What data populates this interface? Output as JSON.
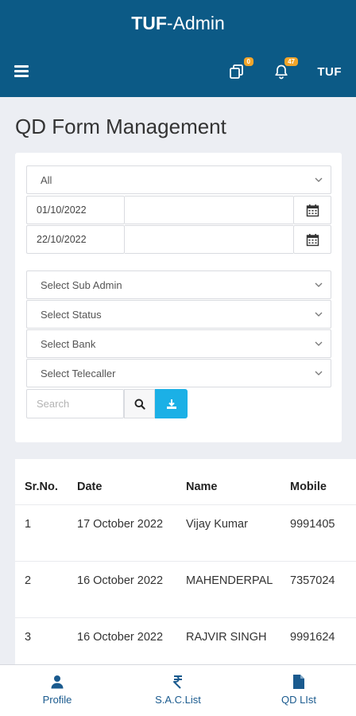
{
  "header": {
    "brand_bold": "TUF",
    "brand_rest": "-Admin",
    "copy_badge": "0",
    "notif_badge": "47",
    "user_label": "TUF"
  },
  "page": {
    "title": "QD Form Management"
  },
  "filters": {
    "type_select": "All",
    "from_date": "01/10/2022",
    "to_date": "22/10/2022",
    "sub_admin": "Select Sub Admin",
    "status": "Select Status",
    "bank": "Select Bank",
    "telecaller": "Select Telecaller",
    "search_placeholder": "Search"
  },
  "table": {
    "headers": [
      "Sr.No.",
      "Date",
      "Name",
      "Mobile"
    ],
    "rows": [
      [
        "1",
        "17 October 2022",
        "Vijay Kumar",
        "9991405"
      ],
      [
        "2",
        "16 October 2022",
        "MAHENDERPAL",
        "7357024"
      ],
      [
        "3",
        "16 October 2022",
        "RAJVIR SINGH",
        "9991624"
      ]
    ]
  },
  "bottom_nav": [
    {
      "label": "Profile",
      "icon": "user-icon"
    },
    {
      "label": "S.A.C.List",
      "icon": "rupee-icon"
    },
    {
      "label": "QD LIst",
      "icon": "document-icon"
    }
  ],
  "colors": {
    "primary": "#0c5a86",
    "accent": "#1bb0e6",
    "badge": "#f2a52a"
  }
}
